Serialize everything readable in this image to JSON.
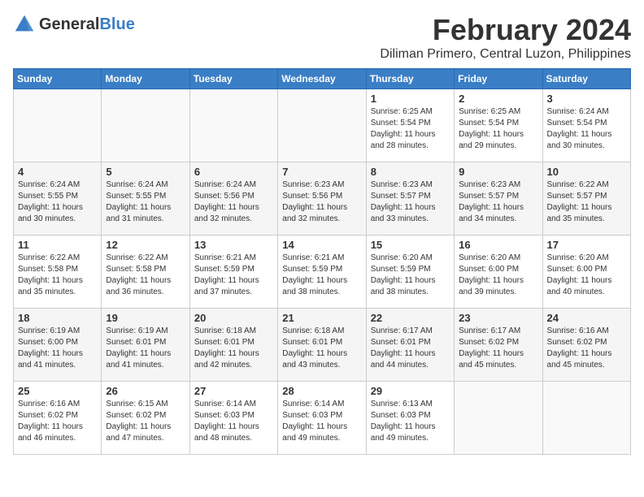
{
  "header": {
    "logo_line1": "General",
    "logo_line2": "Blue",
    "month_year": "February 2024",
    "location": "Diliman Primero, Central Luzon, Philippines"
  },
  "days_of_week": [
    "Sunday",
    "Monday",
    "Tuesday",
    "Wednesday",
    "Thursday",
    "Friday",
    "Saturday"
  ],
  "weeks": [
    [
      {
        "day": "",
        "info": ""
      },
      {
        "day": "",
        "info": ""
      },
      {
        "day": "",
        "info": ""
      },
      {
        "day": "",
        "info": ""
      },
      {
        "day": "1",
        "info": "Sunrise: 6:25 AM\nSunset: 5:54 PM\nDaylight: 11 hours and 28 minutes."
      },
      {
        "day": "2",
        "info": "Sunrise: 6:25 AM\nSunset: 5:54 PM\nDaylight: 11 hours and 29 minutes."
      },
      {
        "day": "3",
        "info": "Sunrise: 6:24 AM\nSunset: 5:54 PM\nDaylight: 11 hours and 30 minutes."
      }
    ],
    [
      {
        "day": "4",
        "info": "Sunrise: 6:24 AM\nSunset: 5:55 PM\nDaylight: 11 hours and 30 minutes."
      },
      {
        "day": "5",
        "info": "Sunrise: 6:24 AM\nSunset: 5:55 PM\nDaylight: 11 hours and 31 minutes."
      },
      {
        "day": "6",
        "info": "Sunrise: 6:24 AM\nSunset: 5:56 PM\nDaylight: 11 hours and 32 minutes."
      },
      {
        "day": "7",
        "info": "Sunrise: 6:23 AM\nSunset: 5:56 PM\nDaylight: 11 hours and 32 minutes."
      },
      {
        "day": "8",
        "info": "Sunrise: 6:23 AM\nSunset: 5:57 PM\nDaylight: 11 hours and 33 minutes."
      },
      {
        "day": "9",
        "info": "Sunrise: 6:23 AM\nSunset: 5:57 PM\nDaylight: 11 hours and 34 minutes."
      },
      {
        "day": "10",
        "info": "Sunrise: 6:22 AM\nSunset: 5:57 PM\nDaylight: 11 hours and 35 minutes."
      }
    ],
    [
      {
        "day": "11",
        "info": "Sunrise: 6:22 AM\nSunset: 5:58 PM\nDaylight: 11 hours and 35 minutes."
      },
      {
        "day": "12",
        "info": "Sunrise: 6:22 AM\nSunset: 5:58 PM\nDaylight: 11 hours and 36 minutes."
      },
      {
        "day": "13",
        "info": "Sunrise: 6:21 AM\nSunset: 5:59 PM\nDaylight: 11 hours and 37 minutes."
      },
      {
        "day": "14",
        "info": "Sunrise: 6:21 AM\nSunset: 5:59 PM\nDaylight: 11 hours and 38 minutes."
      },
      {
        "day": "15",
        "info": "Sunrise: 6:20 AM\nSunset: 5:59 PM\nDaylight: 11 hours and 38 minutes."
      },
      {
        "day": "16",
        "info": "Sunrise: 6:20 AM\nSunset: 6:00 PM\nDaylight: 11 hours and 39 minutes."
      },
      {
        "day": "17",
        "info": "Sunrise: 6:20 AM\nSunset: 6:00 PM\nDaylight: 11 hours and 40 minutes."
      }
    ],
    [
      {
        "day": "18",
        "info": "Sunrise: 6:19 AM\nSunset: 6:00 PM\nDaylight: 11 hours and 41 minutes."
      },
      {
        "day": "19",
        "info": "Sunrise: 6:19 AM\nSunset: 6:01 PM\nDaylight: 11 hours and 41 minutes."
      },
      {
        "day": "20",
        "info": "Sunrise: 6:18 AM\nSunset: 6:01 PM\nDaylight: 11 hours and 42 minutes."
      },
      {
        "day": "21",
        "info": "Sunrise: 6:18 AM\nSunset: 6:01 PM\nDaylight: 11 hours and 43 minutes."
      },
      {
        "day": "22",
        "info": "Sunrise: 6:17 AM\nSunset: 6:01 PM\nDaylight: 11 hours and 44 minutes."
      },
      {
        "day": "23",
        "info": "Sunrise: 6:17 AM\nSunset: 6:02 PM\nDaylight: 11 hours and 45 minutes."
      },
      {
        "day": "24",
        "info": "Sunrise: 6:16 AM\nSunset: 6:02 PM\nDaylight: 11 hours and 45 minutes."
      }
    ],
    [
      {
        "day": "25",
        "info": "Sunrise: 6:16 AM\nSunset: 6:02 PM\nDaylight: 11 hours and 46 minutes."
      },
      {
        "day": "26",
        "info": "Sunrise: 6:15 AM\nSunset: 6:02 PM\nDaylight: 11 hours and 47 minutes."
      },
      {
        "day": "27",
        "info": "Sunrise: 6:14 AM\nSunset: 6:03 PM\nDaylight: 11 hours and 48 minutes."
      },
      {
        "day": "28",
        "info": "Sunrise: 6:14 AM\nSunset: 6:03 PM\nDaylight: 11 hours and 49 minutes."
      },
      {
        "day": "29",
        "info": "Sunrise: 6:13 AM\nSunset: 6:03 PM\nDaylight: 11 hours and 49 minutes."
      },
      {
        "day": "",
        "info": ""
      },
      {
        "day": "",
        "info": ""
      }
    ]
  ]
}
